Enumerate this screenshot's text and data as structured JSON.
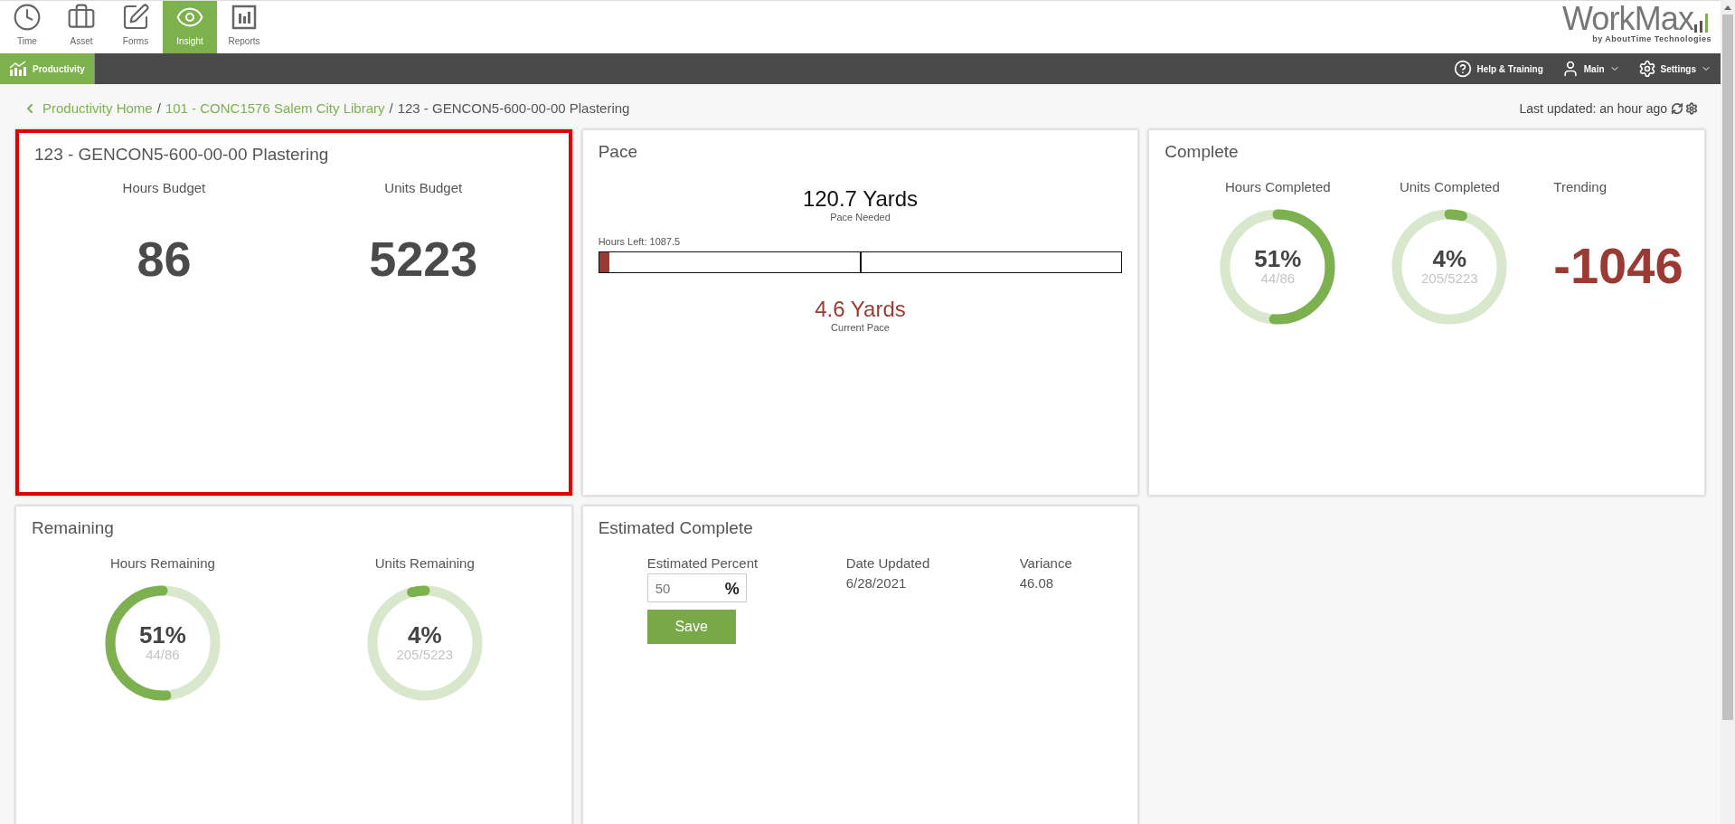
{
  "top_nav": {
    "items": [
      {
        "label": "Time",
        "selected": false
      },
      {
        "label": "Asset",
        "selected": false
      },
      {
        "label": "Forms",
        "selected": false
      },
      {
        "label": "Insight",
        "selected": true
      },
      {
        "label": "Reports",
        "selected": false
      }
    ],
    "logo": {
      "name": "WorkMax",
      "tagline": "by AboutTime Technologies"
    }
  },
  "sub_nav": {
    "items": [
      {
        "label": "Productivity",
        "selected": true
      }
    ],
    "actions": [
      {
        "label": "Help & Training",
        "dropdown": false
      },
      {
        "label": "Main",
        "dropdown": true
      },
      {
        "label": "Settings",
        "dropdown": true
      }
    ]
  },
  "breadcrumb": {
    "links": [
      {
        "label": "Productivity Home",
        "separator": "/"
      },
      {
        "label": "101 - CONC1576 Salem City Library",
        "separator": "/"
      }
    ],
    "current": "123 - GENCON5-600-00-00 Plastering",
    "last_updated": "Last updated: an hour ago"
  },
  "budget_card": {
    "title": "123 - GENCON5-600-00-00 Plastering",
    "highlighted": true,
    "stats": [
      {
        "label": "Hours Budget",
        "value": "86"
      },
      {
        "label": "Units Budget",
        "value": "5223"
      }
    ]
  },
  "pace_card": {
    "title": "Pace",
    "needed": "120.7 Yards",
    "needed_label": "Pace Needed",
    "hours_left": "Hours Left: 1087.5",
    "level": 0.02,
    "current": "4.6 Yards",
    "current_label": "Current Pace"
  },
  "complete_card": {
    "title": "Complete",
    "gauges": [
      {
        "label": "Hours Completed",
        "percent": "51%",
        "detail": "44/86",
        "level": 0.51
      },
      {
        "label": "Units Completed",
        "percent": "4%",
        "detail": "205/5223",
        "level": 0.04
      }
    ],
    "trending": {
      "label": "Trending",
      "value": "-1046"
    }
  },
  "remaining_card": {
    "title": "Remaining",
    "gauges": [
      {
        "label": "Hours Remaining",
        "percent": "51%",
        "detail": "44/86",
        "level": 0.51
      },
      {
        "label": "Units Remaining",
        "percent": "4%",
        "detail": "205/5223",
        "level": 0.04
      }
    ]
  },
  "estimated_card": {
    "title": "Estimated Complete",
    "percent_label": "Estimated Percent",
    "percent_value": "50",
    "percent_unit": "%",
    "date_label": "Date Updated",
    "date": "6/28/2021",
    "variance_label": "Variance",
    "variance": "46.08",
    "save": "Save"
  }
}
